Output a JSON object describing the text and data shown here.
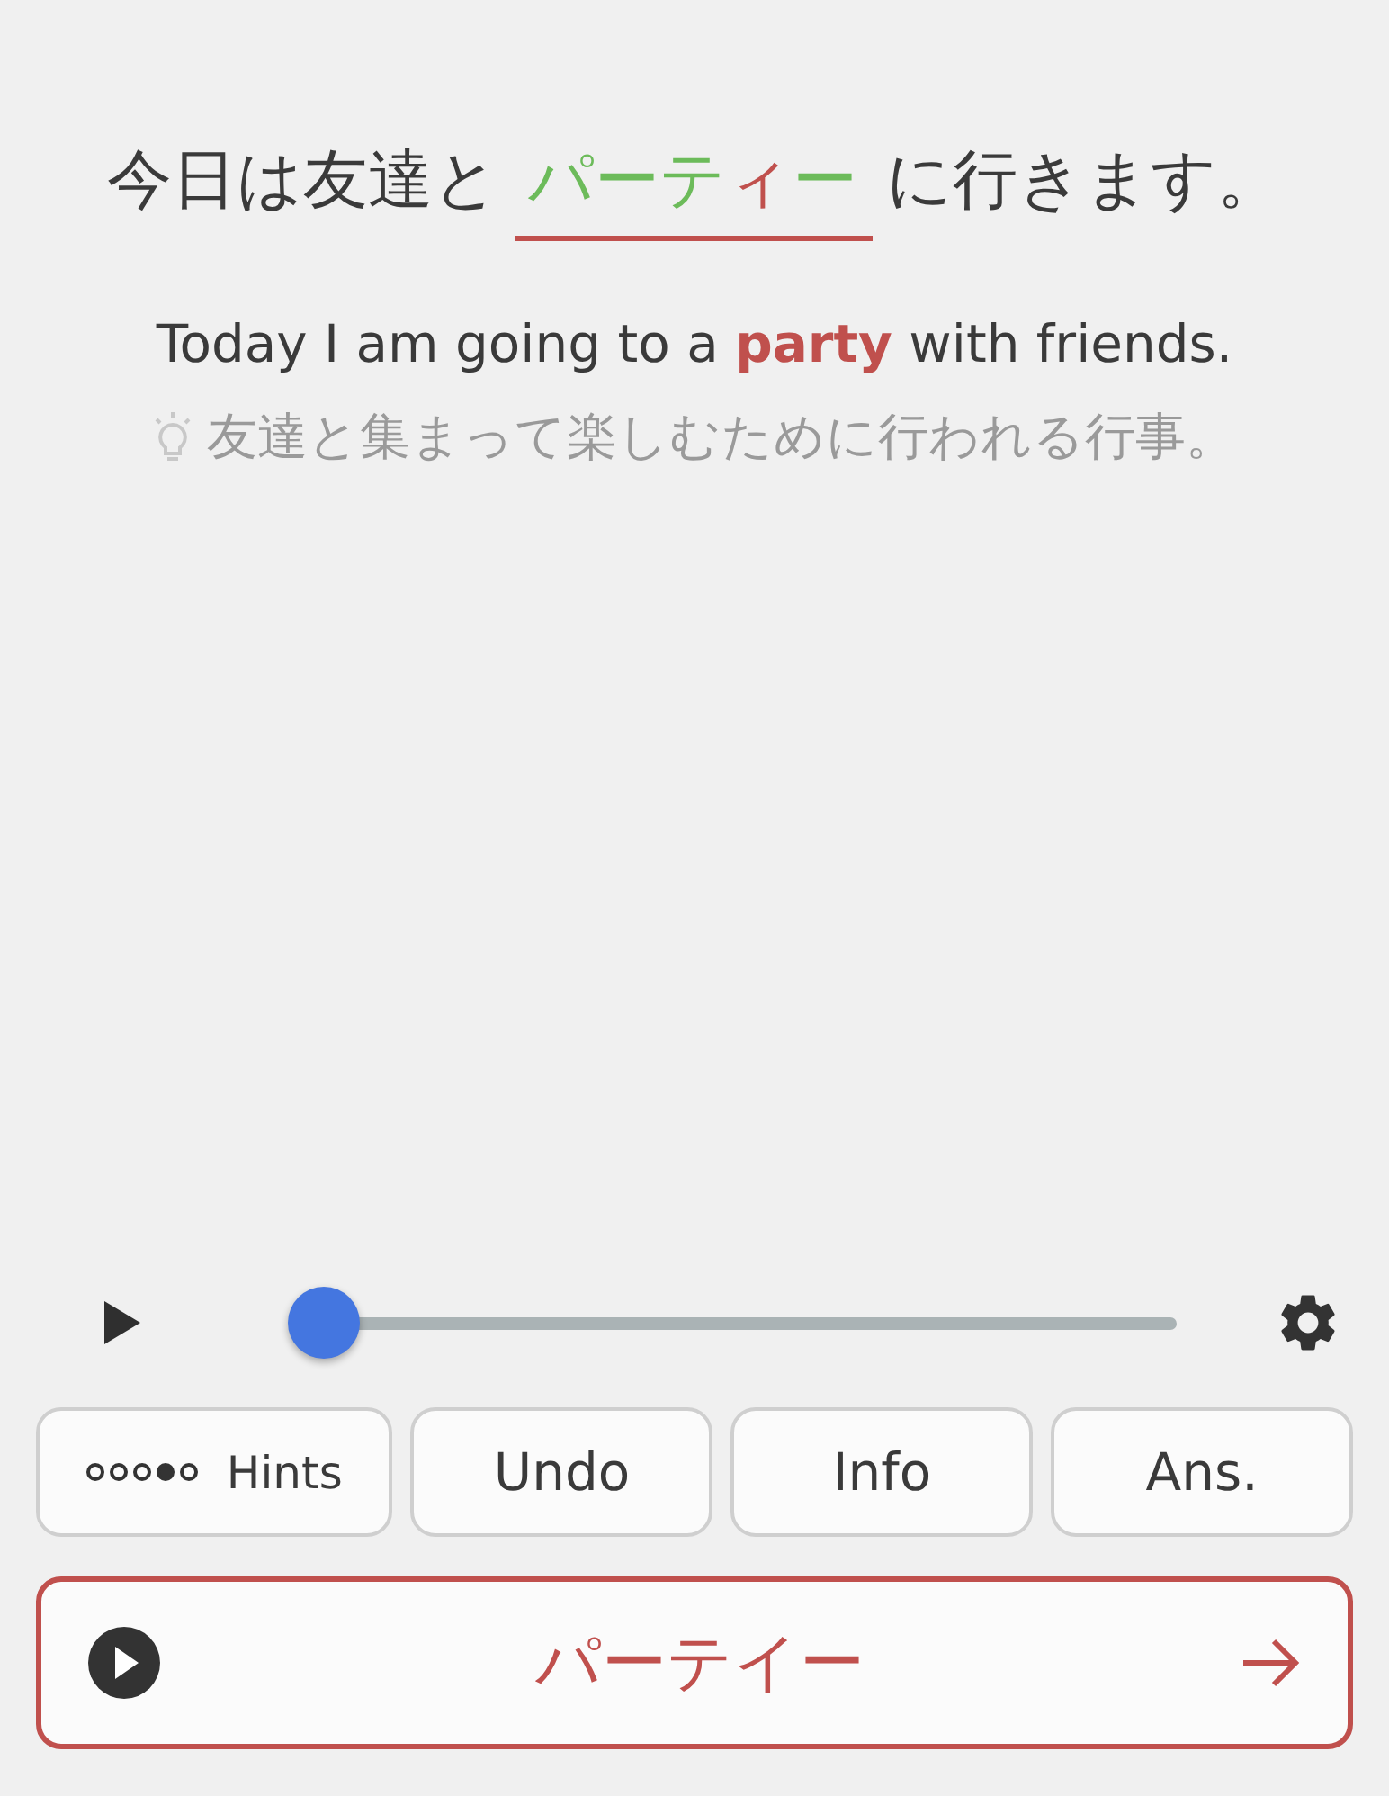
{
  "sentence": {
    "before": "今日は友達と",
    "answer": [
      {
        "text": "パーテ",
        "correct": true
      },
      {
        "text": "ィ",
        "correct": false
      },
      {
        "text": "ー",
        "correct": true
      }
    ],
    "after": "に行きます。"
  },
  "translation": "Today I am going to a **party** with friends.",
  "hint": "友達と集まって楽しむために行われる行事。",
  "player": {
    "level": 0
  },
  "hint_dots": [
    {
      "filled": false
    },
    {
      "filled": false
    },
    {
      "filled": false
    },
    {
      "filled": true
    },
    {
      "filled": false
    }
  ],
  "buttons": [
    {
      "kind": "hints",
      "label": "Hints"
    },
    {
      "kind": "plain",
      "label": "Undo"
    },
    {
      "kind": "plain",
      "label": "Info"
    },
    {
      "kind": "plain",
      "label": "Ans."
    }
  ],
  "answer_bar": {
    "text": "パーテイー"
  }
}
